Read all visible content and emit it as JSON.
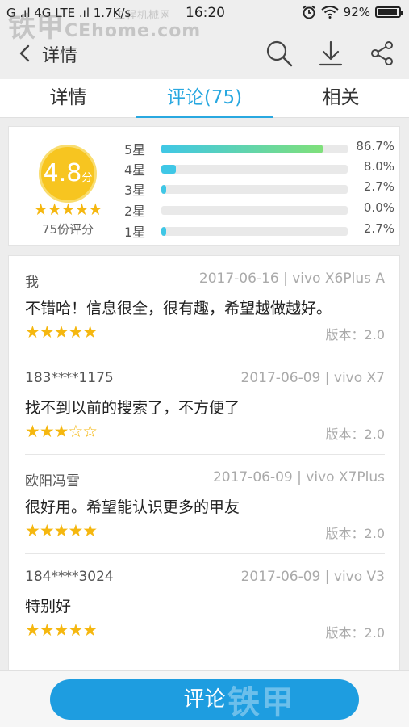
{
  "statusbar": {
    "left": "G .ıl 4G LTE .ıl 1.7K/s",
    "time": "16:20",
    "battery": "92%",
    "battery_level": 0.92
  },
  "watermark": {
    "brand": "铁甲",
    "site": "CEhome.com",
    "tagline": "工程机械网"
  },
  "topbar": {
    "title": "详情"
  },
  "tabs": [
    {
      "label": "详情"
    },
    {
      "label": "评论(75)"
    },
    {
      "label": "相关"
    }
  ],
  "summary": {
    "score": "4.8",
    "unit": "分",
    "stars": "★★★★★",
    "count_text": "75份评分",
    "rows": [
      {
        "label": "5星",
        "pct": "86.7%",
        "value": 86.7
      },
      {
        "label": "4星",
        "pct": "8.0%",
        "value": 8.0
      },
      {
        "label": "3星",
        "pct": "2.7%",
        "value": 2.7
      },
      {
        "label": "2星",
        "pct": "0.0%",
        "value": 0.0
      },
      {
        "label": "1星",
        "pct": "2.7%",
        "value": 2.7
      }
    ]
  },
  "reviews": [
    {
      "user": "我",
      "meta": "2017-06-16 | vivo X6Plus A",
      "content": "不错哈！信息很全，很有趣，希望越做越好。",
      "stars": "★★★★★",
      "version": "版本：2.0"
    },
    {
      "user": "183****1175",
      "meta": "2017-06-09 | vivo X7",
      "content": "找不到以前的搜索了，不方便了",
      "stars": "★★★☆☆",
      "version": "版本：2.0"
    },
    {
      "user": "欧阳冯雪",
      "meta": "2017-06-09 | vivo X7Plus",
      "content": "很好用。希望能认识更多的甲友",
      "stars": "★★★★★",
      "version": "版本：2.0"
    },
    {
      "user": "184****3024",
      "meta": "2017-06-09 | vivo V3",
      "content": "特别好",
      "stars": "★★★★★",
      "version": "版本：2.0"
    }
  ],
  "bottom": {
    "button_label": "评论",
    "watermark": "铁甲"
  },
  "colors": {
    "accent": "#29a8e0",
    "star": "#f5b70f",
    "score_circle": "#f7c520",
    "button": "#1e9de0"
  }
}
